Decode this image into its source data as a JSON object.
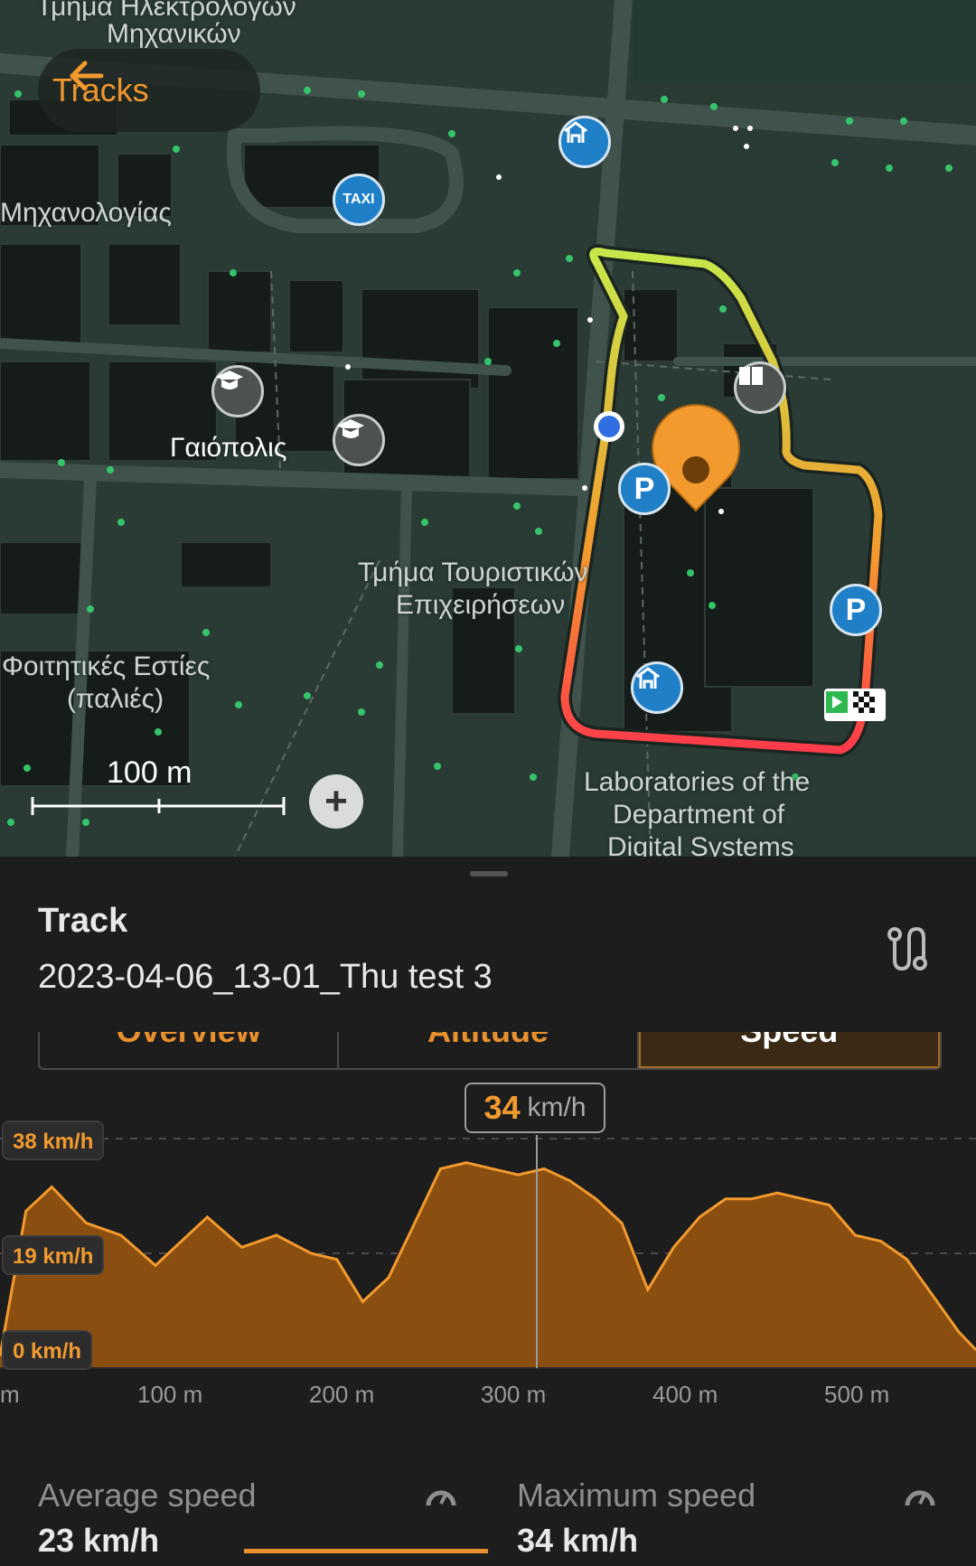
{
  "header": {
    "back_label": "Tracks"
  },
  "map": {
    "labels": {
      "electrical_top": "Τμήμα Ηλεκτρολόγων",
      "electrical_bottom": "Μηχανικών",
      "mechanical": "Μηχανολογίας",
      "gaiopolis": "Γαιόπολις",
      "tourism_top": "Τμήμα Τουριστικών",
      "tourism_bottom": "Επιχειρήσεων",
      "dorms_top": "Φοιτητικές Εστίες",
      "dorms_bottom": "(παλιές)",
      "labs_1": "Laboratories of the",
      "labs_2": "Department of",
      "labs_3": "Digital Systems"
    },
    "scale_label": "100 m",
    "poi_icons": [
      "taxi-icon",
      "shelter-icon",
      "education-icon",
      "parking-icon",
      "library-icon",
      "start-finish-icon"
    ]
  },
  "sheet": {
    "title": "Track",
    "track_name": "2023-04-06_13-01_Thu test 3",
    "tabs": [
      "Overview",
      "Altitude",
      "Speed"
    ],
    "selected_tab": "Speed",
    "tooltip": {
      "value": "34",
      "unit": "km/h"
    },
    "stats": {
      "avg_label": "Average speed",
      "avg_value": "23 km/h",
      "max_label": "Maximum speed",
      "max_value": "34 km/h"
    }
  },
  "chart_data": {
    "type": "area",
    "xlabel": "",
    "ylabel": "",
    "y_tick_labels": [
      "38 km/h",
      "19 km/h",
      "0 km/h"
    ],
    "x_tick_labels": [
      "m",
      "100 m",
      "200 m",
      "300 m",
      "400 m",
      "500 m"
    ],
    "xlim": [
      0,
      565
    ],
    "ylim": [
      0,
      38
    ],
    "x": [
      0,
      15,
      30,
      50,
      70,
      90,
      105,
      120,
      140,
      160,
      180,
      195,
      210,
      225,
      240,
      255,
      270,
      285,
      300,
      315,
      330,
      345,
      360,
      375,
      390,
      405,
      420,
      435,
      450,
      465,
      480,
      495,
      510,
      525,
      540,
      555,
      565
    ],
    "values": [
      2,
      26,
      30,
      24,
      22,
      17,
      21,
      25,
      20,
      22,
      19,
      18,
      11,
      15,
      24,
      33,
      34,
      33,
      32,
      33,
      31,
      28,
      24,
      13,
      20,
      25,
      28,
      28,
      29,
      28,
      27,
      22,
      21,
      18,
      12,
      6,
      3
    ],
    "series": [
      {
        "color": "#f39a2e"
      }
    ]
  },
  "colors": {
    "accent": "#f39a2e",
    "area_fill": "#8a4f10",
    "route_start": "#b8e64a",
    "route_mid": "#f39a2e",
    "route_hot": "#ff3b4a"
  }
}
